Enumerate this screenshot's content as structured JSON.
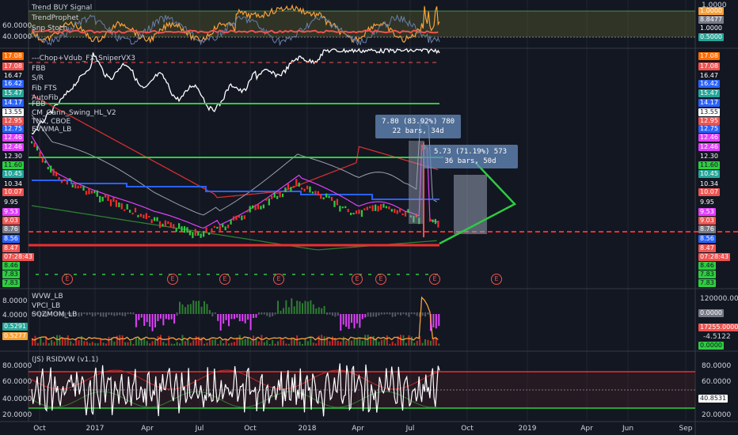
{
  "colors": {
    "bg": "#131722",
    "grid": "#1f2433",
    "text": "#d1d4dc",
    "green": "#26a69a",
    "brightgreen": "#2ecc40",
    "red": "#ef5350",
    "blue": "#2962ff",
    "white": "#ffffff",
    "orange": "#f7a13a",
    "magenta": "#e040fb",
    "gray": "#787b86"
  },
  "panes": {
    "stoch": {
      "labels": [
        "Trend BUY Signal",
        "TrendProphet",
        "Snp Stoch"
      ],
      "left_axis": [
        "60.0000",
        "40.0000"
      ],
      "right_axis": [
        "1.0000",
        "8.8477",
        "1.0000",
        "0.5000"
      ]
    },
    "main": {
      "labels": [
        "---Chop+Vdub_FX_SniperVX3",
        "FBB",
        "S/R",
        "Fib FTS",
        "AutoFib",
        "FBB",
        "CM_Gann_Swing_HL_V2",
        "TNX, CBOE",
        "EVWMA_LB"
      ],
      "left_axis": [
        "17.08",
        "17.08",
        "16.47",
        "16.42",
        "15.47",
        "14.17",
        "13.55",
        "12.95",
        "12.75",
        "12.46",
        "12.46",
        "12.30",
        "11.60",
        "10.45",
        "10.34",
        "10.07",
        "9.95",
        "9.53",
        "9.03",
        "8.76",
        "8.56",
        "8.47",
        "07:28:43",
        "8.47",
        "8.46",
        "7.83",
        "7.83"
      ],
      "right_axis": [
        "17.08",
        "17.08",
        "16.47",
        "16.42",
        "15.47",
        "14.17",
        "13.55",
        "12.95",
        "12.75",
        "12.46",
        "12.46",
        "12.30",
        "11.60",
        "10.45",
        "10.34",
        "10.07",
        "9.95",
        "9.53",
        "9.03",
        "8.76",
        "8.56",
        "8.47",
        "07:28:43",
        "8.46",
        "7.83",
        "7.83"
      ],
      "earnings_marker": "E",
      "callout_1": {
        "line1": "7.80 (83.92%) 780",
        "line2": "22 bars, 34d"
      },
      "callout_2": {
        "line1": "5.73 (71.19%) 573",
        "line2": "36 bars, 50d"
      }
    },
    "wvw": {
      "labels": [
        "WVW_LB",
        "VPCI_LB",
        "SQZMOM_LB"
      ],
      "left_axis": [
        "8.0000",
        "4.0000",
        "0.5291",
        "0.5277"
      ],
      "right_axis": [
        "120000.0000",
        "0.0000",
        "17255.0000",
        "-4.5122",
        "0.0000",
        "0.0000"
      ]
    },
    "rsi": {
      "labels": [
        "(JS) RSIDVW (v1.1)"
      ],
      "left_axis": [
        "80.0000",
        "60.0000",
        "40.0000",
        "20.0000"
      ],
      "right_axis": [
        "80.0000",
        "60.0000",
        "40.8531",
        "20.0000"
      ]
    }
  },
  "time_axis": [
    "Oct",
    "2017",
    "Apr",
    "Jul",
    "Oct",
    "2018",
    "Apr",
    "Jul",
    "Oct",
    "2019",
    "Apr",
    "Jun",
    "Sep"
  ]
}
